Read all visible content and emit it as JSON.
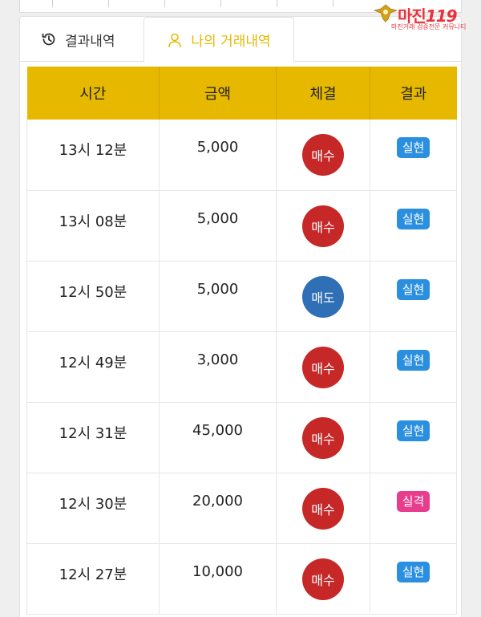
{
  "watermark": {
    "brand": "마진",
    "mark": "119",
    "tagline": "마진거래 검증전문 커뮤니티"
  },
  "tabs": [
    {
      "label": "결과내역",
      "icon": "history-icon",
      "active": false
    },
    {
      "label": "나의 거래내역",
      "icon": "user-icon",
      "active": true
    }
  ],
  "colors": {
    "header_bg": "#e6b800",
    "buy": "#c62828",
    "sell": "#2e6fb5",
    "realized": "#2b8fe0",
    "failed": "#e83c8c"
  },
  "table": {
    "headers": [
      "시간",
      "금액",
      "체결",
      "결과"
    ],
    "rows": [
      {
        "time": "13시 12분",
        "amount": "5,000",
        "trade": "매수",
        "trade_type": "buy",
        "result": "실현",
        "result_type": "ok"
      },
      {
        "time": "13시 08분",
        "amount": "5,000",
        "trade": "매수",
        "trade_type": "buy",
        "result": "실현",
        "result_type": "ok"
      },
      {
        "time": "12시 50분",
        "amount": "5,000",
        "trade": "매도",
        "trade_type": "sell",
        "result": "실현",
        "result_type": "ok"
      },
      {
        "time": "12시 49분",
        "amount": "3,000",
        "trade": "매수",
        "trade_type": "buy",
        "result": "실현",
        "result_type": "ok"
      },
      {
        "time": "12시 31분",
        "amount": "45,000",
        "trade": "매수",
        "trade_type": "buy",
        "result": "실현",
        "result_type": "ok"
      },
      {
        "time": "12시 30분",
        "amount": "20,000",
        "trade": "매수",
        "trade_type": "buy",
        "result": "실격",
        "result_type": "fail"
      },
      {
        "time": "12시 27분",
        "amount": "10,000",
        "trade": "매수",
        "trade_type": "buy",
        "result": "실현",
        "result_type": "ok"
      }
    ]
  }
}
